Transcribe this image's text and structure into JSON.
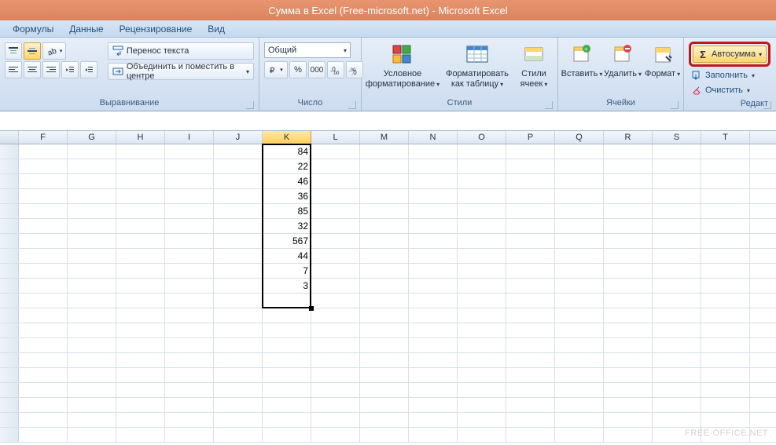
{
  "title": "Сумма в Excel (Free-microsoft.net) - Microsoft Excel",
  "tabs": [
    "Формулы",
    "Данные",
    "Рецензирование",
    "Вид"
  ],
  "alignment": {
    "wrap": "Перенос текста",
    "merge": "Объединить и поместить в центре",
    "label": "Выравнивание"
  },
  "number": {
    "format": "Общий",
    "label": "Число"
  },
  "styles": {
    "cond": "Условное форматирование",
    "table": "Форматировать как таблицу",
    "cell": "Стили ячеек",
    "label": "Стили"
  },
  "cells": {
    "insert": "Вставить",
    "delete": "Удалить",
    "format": "Формат",
    "label": "Ячейки"
  },
  "editing": {
    "autosum": "Автосумма",
    "fill": "Заполнить",
    "clear": "Очистить",
    "label": "Редакт"
  },
  "columns": [
    "F",
    "G",
    "H",
    "I",
    "J",
    "K",
    "L",
    "M",
    "N",
    "O",
    "P",
    "Q",
    "R",
    "S",
    "T"
  ],
  "selected_column": "K",
  "values": [
    84,
    22,
    46,
    36,
    85,
    32,
    567,
    44,
    7,
    3
  ],
  "watermark": "FREE-OFFICE.NET"
}
